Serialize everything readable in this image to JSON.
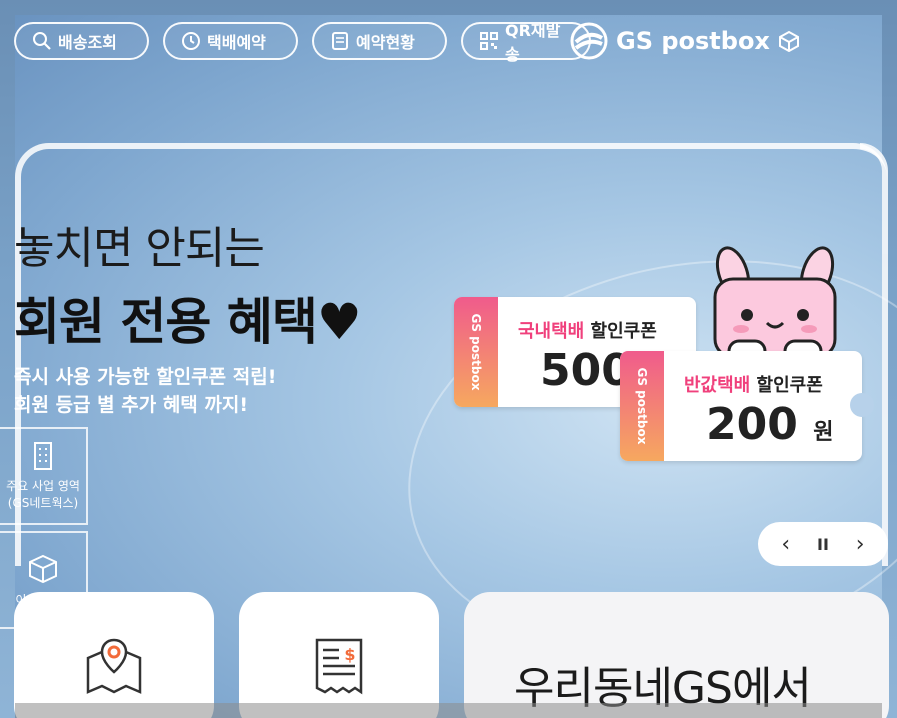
{
  "nav": {
    "items": [
      {
        "label": "배송조회",
        "icon": "search-icon"
      },
      {
        "label": "택배예약",
        "icon": "clock-icon"
      },
      {
        "label": "예약현황",
        "icon": "document-icon"
      },
      {
        "label": "QR재발송",
        "icon": "qr-icon"
      }
    ]
  },
  "logo": {
    "text": "GS postbox"
  },
  "banner": {
    "headline1": "놓치면 안되는",
    "headline2": "회원 전용 혜택♥",
    "sub1": "즉시 사용 가능한 할인쿠폰 적립!",
    "sub2": "회원 등급 별 추가 혜택 까지!"
  },
  "coupons": [
    {
      "stub": "GS postbox",
      "title_pink": "국내택배",
      "title_black": "할인쿠폰",
      "amount": "500",
      "unit": ""
    },
    {
      "stub": "GS postbox",
      "title_pink": "반값택배",
      "title_black": "할인쿠폰",
      "amount": "200",
      "unit": "원"
    }
  ],
  "slider": {
    "prev": "‹",
    "pause": "II",
    "next": "›"
  },
  "side": {
    "item1": {
      "label_line1": "주요 사업 영역",
      "label_line2": "(GS네트웍스)",
      "icon": "building-icon"
    },
    "item2": {
      "label": "이용가이드",
      "icon": "box-icon"
    }
  },
  "cards": {
    "card1_icon": "map-pin-icon",
    "card2_icon": "receipt-icon",
    "card3_text": "우리동네GS에서"
  },
  "colors": {
    "accent_pink": "#f0407c",
    "accent_orange": "#f6a85f"
  }
}
